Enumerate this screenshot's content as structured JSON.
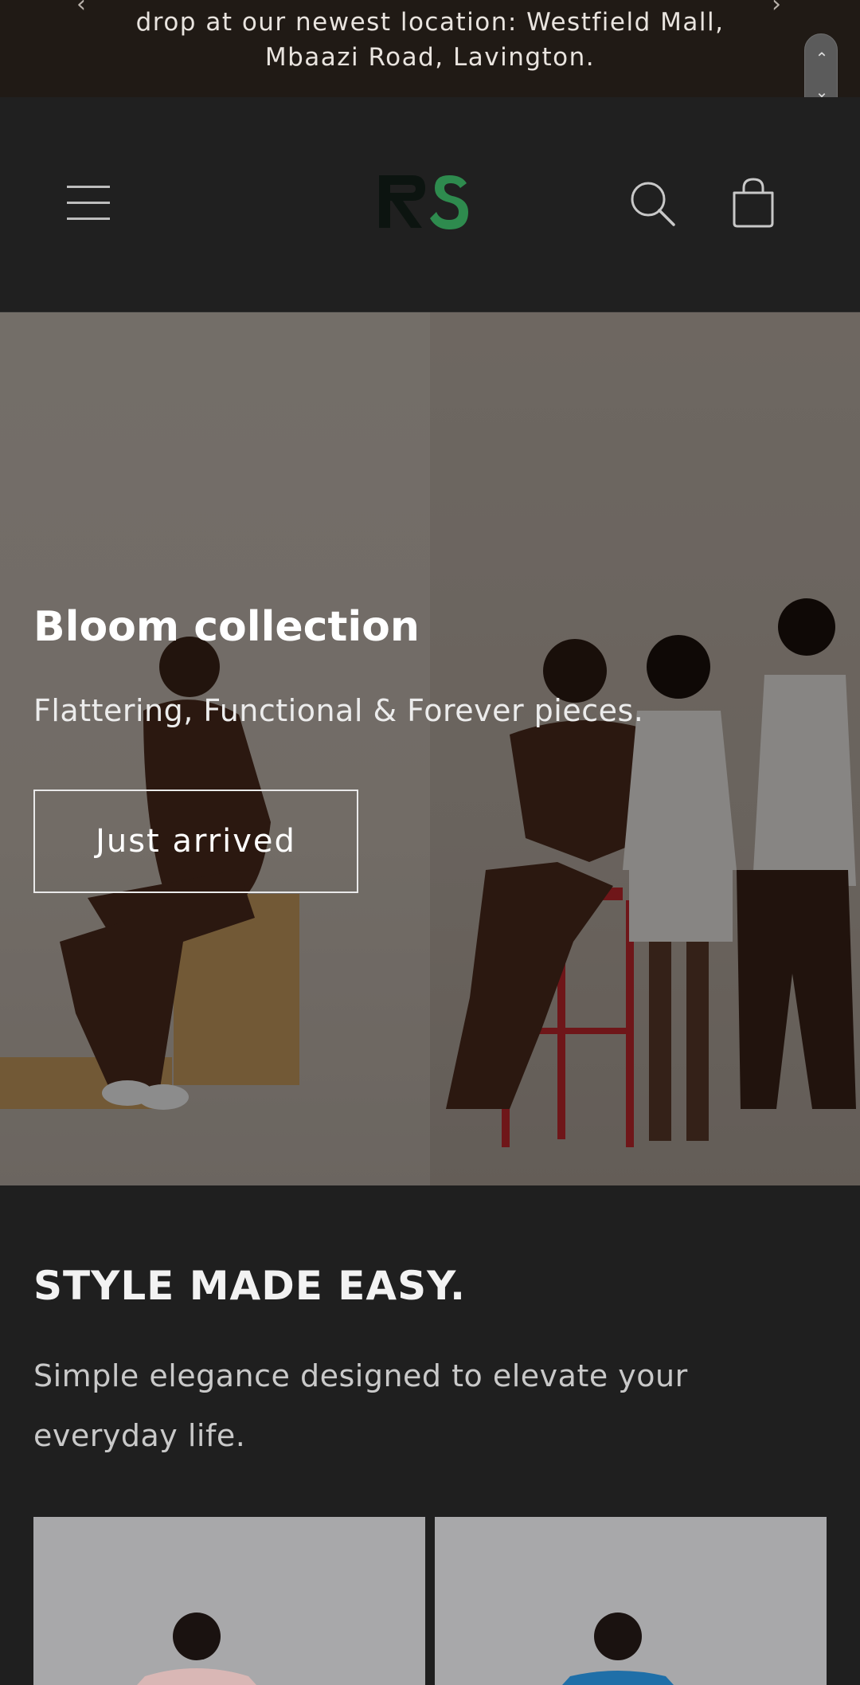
{
  "announcement": {
    "text": "drop at our newest location: Westfield Mall, Mbaazi Road, Lavington.",
    "prev_icon": "chevron-left-icon",
    "next_icon": "chevron-right-icon"
  },
  "header": {
    "menu_icon": "hamburger-menu-icon",
    "logo_text": "RS",
    "search_icon": "search-icon",
    "cart_icon": "cart-bag-icon"
  },
  "hero": {
    "title": "Bloom collection",
    "subtitle": "Flattering, Functional & Forever pieces.",
    "cta_label": "Just arrived"
  },
  "section": {
    "title": "STYLE MADE EASY.",
    "text": "Simple elegance designed to elevate your everyday life."
  },
  "colors": {
    "background": "#1f1f1f",
    "announcement_bg": "#201a15",
    "logo_green": "#2e8b4e"
  }
}
